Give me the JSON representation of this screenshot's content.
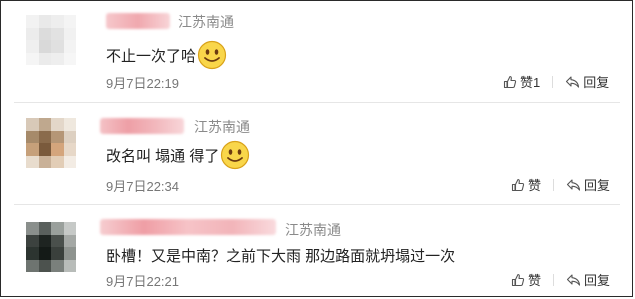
{
  "colors": {
    "accent_name_blur": "#f0a8ae",
    "location_gray": "#8a8a8a",
    "text": "#222222"
  },
  "comments": [
    {
      "location": "江苏南通",
      "text": "不止一次了哈",
      "emoji": "smiley-face-icon",
      "time": "9月7日22:19",
      "like_label": "赞1",
      "reply_label": "回复"
    },
    {
      "location": "江苏南通",
      "text": "改名叫 塌通 得了",
      "emoji": "smiley-face-icon",
      "time": "9月7日22:34",
      "like_label": "赞",
      "reply_label": "回复"
    },
    {
      "location": "江苏南通",
      "text": "卧槽！又是中南？之前下大雨 那边路面就坍塌过一次",
      "emoji": "",
      "time": "9月7日22:21",
      "like_label": "赞",
      "reply_label": "回复"
    }
  ]
}
